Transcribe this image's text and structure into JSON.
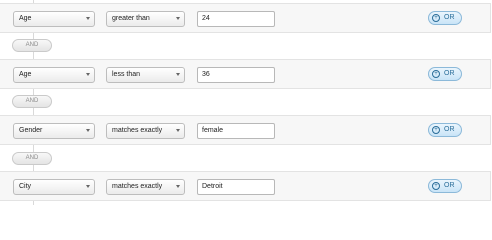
{
  "rules": [
    {
      "field": "Age",
      "operator": "greater than",
      "value": "24",
      "or_label": "OR"
    },
    {
      "field": "Age",
      "operator": "less than",
      "value": "36",
      "or_label": "OR"
    },
    {
      "field": "Gender",
      "operator": "matches exactly",
      "value": "female",
      "or_label": "OR"
    },
    {
      "field": "City",
      "operator": "matches exactly",
      "value": "Detroit",
      "or_label": "OR"
    }
  ],
  "connectors": [
    "AND",
    "AND",
    "AND"
  ]
}
